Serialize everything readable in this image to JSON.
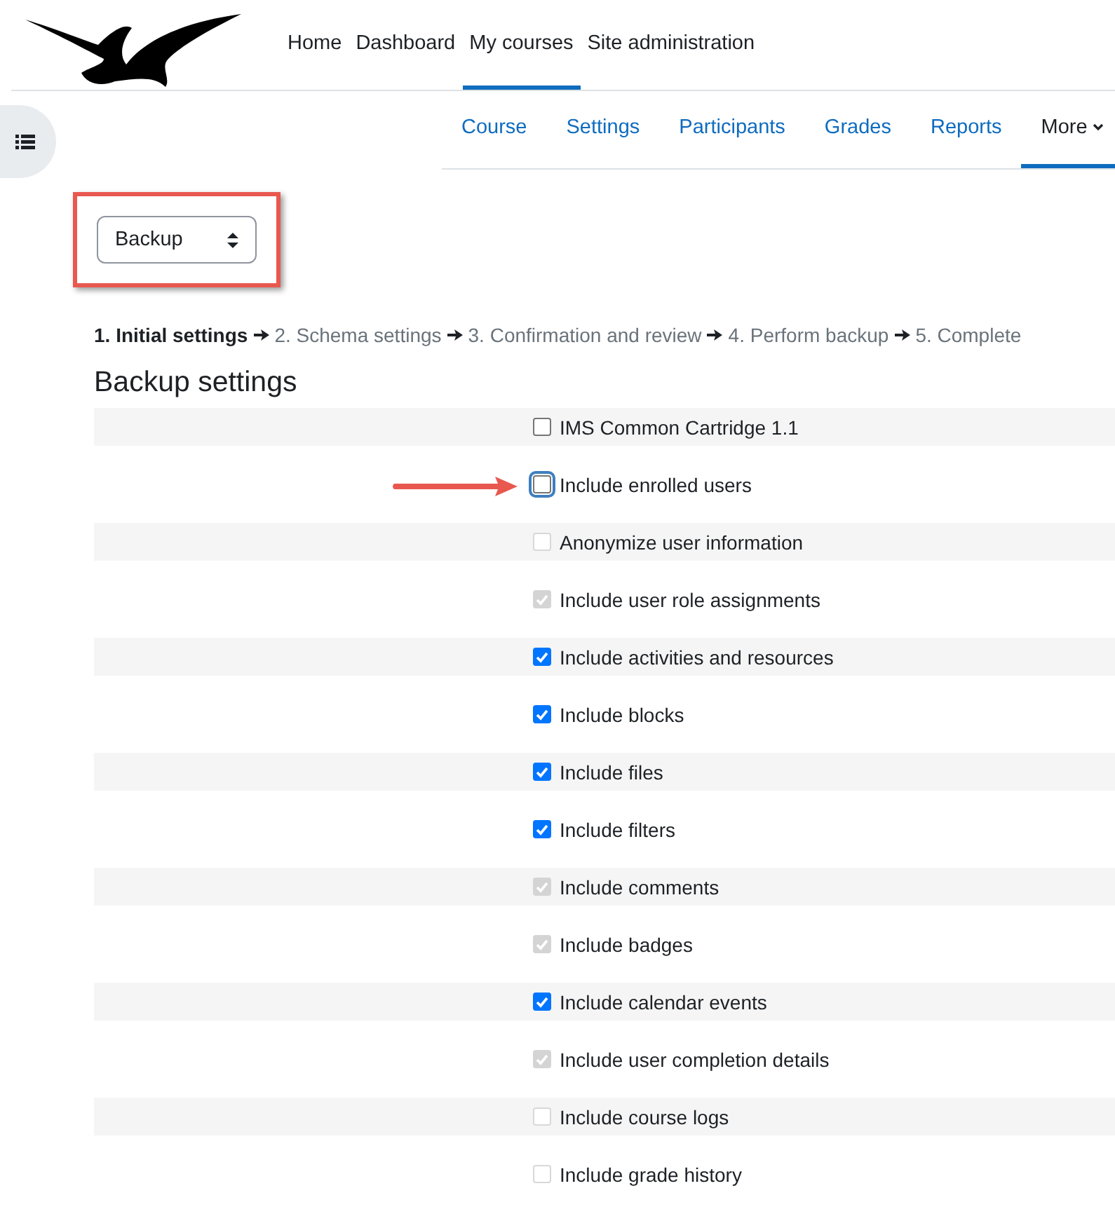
{
  "primary_nav": [
    {
      "label": "Home",
      "selected": false
    },
    {
      "label": "Dashboard",
      "selected": false
    },
    {
      "label": "My courses",
      "selected": true
    },
    {
      "label": "Site administration",
      "selected": false
    }
  ],
  "secondary_nav": [
    {
      "label": "Course",
      "selected": false,
      "kind": "link"
    },
    {
      "label": "Settings",
      "selected": false,
      "kind": "link"
    },
    {
      "label": "Participants",
      "selected": false,
      "kind": "link"
    },
    {
      "label": "Grades",
      "selected": false,
      "kind": "link"
    },
    {
      "label": "Reports",
      "selected": false,
      "kind": "link"
    },
    {
      "label": "More",
      "selected": true,
      "kind": "menu"
    }
  ],
  "action_select": {
    "value": "Backup",
    "highlighted": true
  },
  "steps": [
    {
      "label": "1. Initial settings",
      "selected": true
    },
    {
      "label": "2. Schema settings",
      "selected": false
    },
    {
      "label": "3. Confirmation and review",
      "selected": false
    },
    {
      "label": "4. Perform backup",
      "selected": false
    },
    {
      "label": "5. Complete",
      "selected": false
    }
  ],
  "heading": "Backup settings",
  "settings": [
    {
      "label": "IMS Common Cartridge 1.1",
      "checked": false,
      "disabled": false,
      "highlighted": false
    },
    {
      "label": "Include enrolled users",
      "checked": false,
      "disabled": false,
      "highlighted": true
    },
    {
      "label": "Anonymize user information",
      "checked": false,
      "disabled": true,
      "highlighted": false
    },
    {
      "label": "Include user role assignments",
      "checked": true,
      "disabled": true,
      "highlighted": false
    },
    {
      "label": "Include activities and resources",
      "checked": true,
      "disabled": false,
      "highlighted": false
    },
    {
      "label": "Include blocks",
      "checked": true,
      "disabled": false,
      "highlighted": false
    },
    {
      "label": "Include files",
      "checked": true,
      "disabled": false,
      "highlighted": false
    },
    {
      "label": "Include filters",
      "checked": true,
      "disabled": false,
      "highlighted": false
    },
    {
      "label": "Include comments",
      "checked": true,
      "disabled": true,
      "highlighted": false
    },
    {
      "label": "Include badges",
      "checked": true,
      "disabled": true,
      "highlighted": false
    },
    {
      "label": "Include calendar events",
      "checked": true,
      "disabled": false,
      "highlighted": false
    },
    {
      "label": "Include user completion details",
      "checked": true,
      "disabled": true,
      "highlighted": false
    },
    {
      "label": "Include course logs",
      "checked": false,
      "disabled": true,
      "highlighted": false
    },
    {
      "label": "Include grade history",
      "checked": false,
      "disabled": true,
      "highlighted": false
    }
  ]
}
